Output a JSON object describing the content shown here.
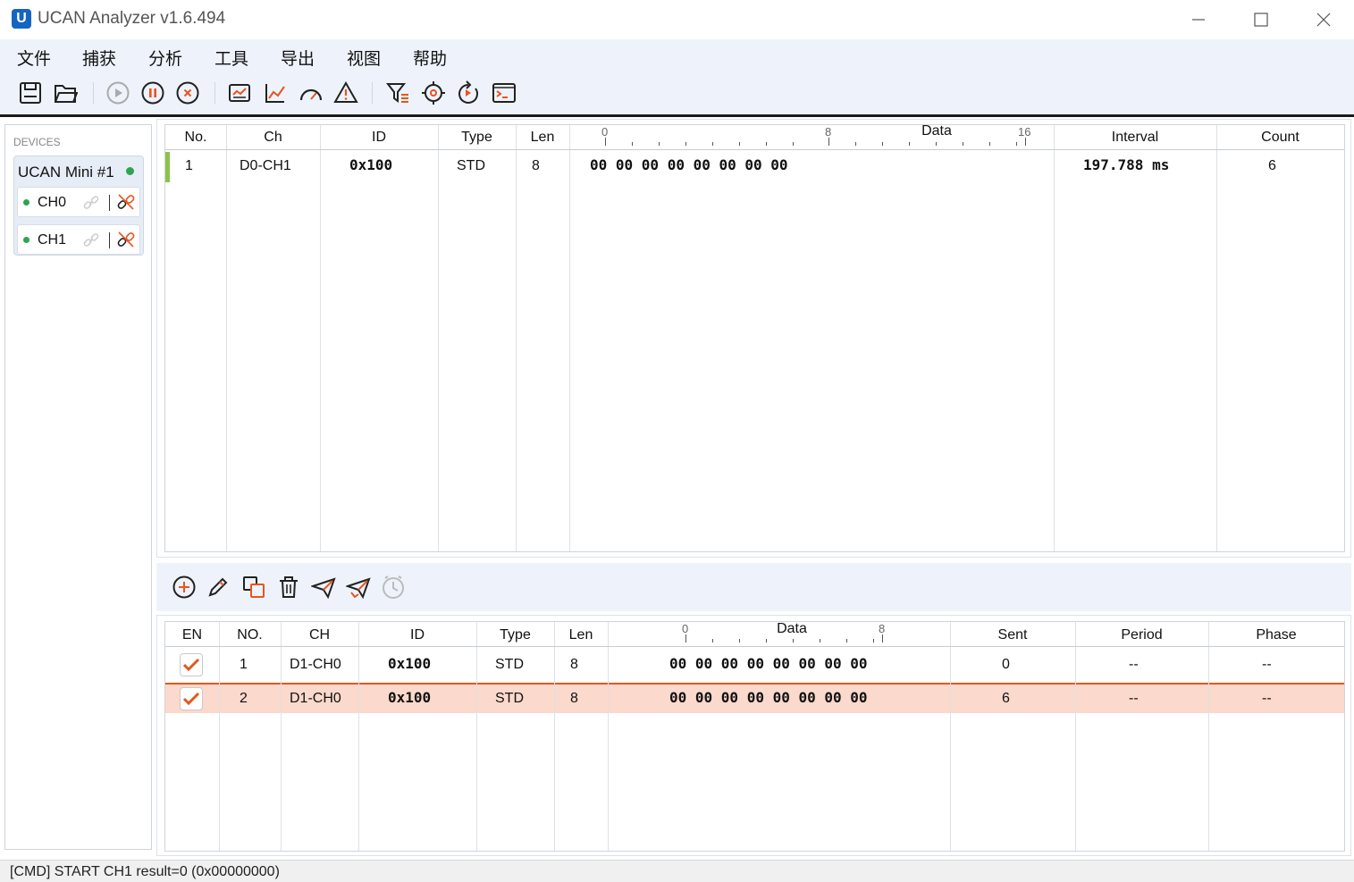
{
  "window": {
    "title": "UCAN Analyzer v1.6.494",
    "minimize_icon": "minimize-icon",
    "maximize_icon": "maximize-icon",
    "close_icon": "close-icon"
  },
  "menu": {
    "items": [
      "文件",
      "捕获",
      "分析",
      "工具",
      "导出",
      "视图",
      "帮助"
    ]
  },
  "toolbar": {
    "icons": [
      "save-icon",
      "open-folder-icon",
      "play-icon",
      "pause-icon",
      "stop-icon",
      "monitor-chart-icon",
      "line-chart-icon",
      "gauge-icon",
      "warning-icon",
      "filter-icon",
      "target-icon",
      "refresh-icon",
      "terminal-icon"
    ]
  },
  "devices": {
    "header": "DEVICES",
    "device_name": "UCAN Mini #1",
    "status_color": "#2ea44f",
    "channels": [
      {
        "label": "CH0",
        "connected": true
      },
      {
        "label": "CH1",
        "connected": true
      }
    ]
  },
  "rx_table": {
    "headers": {
      "no": "No.",
      "ch": "Ch",
      "id": "ID",
      "type": "Type",
      "len": "Len",
      "data": "Data",
      "interval": "Interval",
      "count": "Count"
    },
    "ruler": {
      "start": "0",
      "mid": "8",
      "end": "16"
    },
    "rows": [
      {
        "no": "1",
        "ch": "D0-CH1",
        "id": "0x100",
        "type": "STD",
        "len": "8",
        "data": "00 00 00 00 00 00 00 00",
        "interval": "197.788 ms",
        "count": "6"
      }
    ]
  },
  "tx_toolbar": {
    "icons": [
      "add-icon",
      "edit-icon",
      "copy-icon",
      "delete-icon",
      "send-icon",
      "send-all-icon",
      "timer-icon"
    ]
  },
  "tx_table": {
    "headers": {
      "en": "EN",
      "no": "NO.",
      "ch": "CH",
      "id": "ID",
      "type": "Type",
      "len": "Len",
      "data": "Data",
      "sent": "Sent",
      "period": "Period",
      "phase": "Phase"
    },
    "ruler": {
      "start": "0",
      "end": "8"
    },
    "rows": [
      {
        "en": true,
        "no": "1",
        "ch": "D1-CH0",
        "id": "0x100",
        "type": "STD",
        "len": "8",
        "data": "00 00 00 00 00 00 00 00",
        "sent": "0",
        "period": "--",
        "phase": "--",
        "selected": false
      },
      {
        "en": true,
        "no": "2",
        "ch": "D1-CH0",
        "id": "0x100",
        "type": "STD",
        "len": "8",
        "data": "00 00 00 00 00 00 00 00",
        "sent": "6",
        "period": "--",
        "phase": "--",
        "selected": true
      }
    ],
    "accent_color": "#e8551f",
    "selected_row_color": "#fbd9cc"
  },
  "status": {
    "text": "[CMD] START CH1 result=0 (0x00000000)"
  }
}
